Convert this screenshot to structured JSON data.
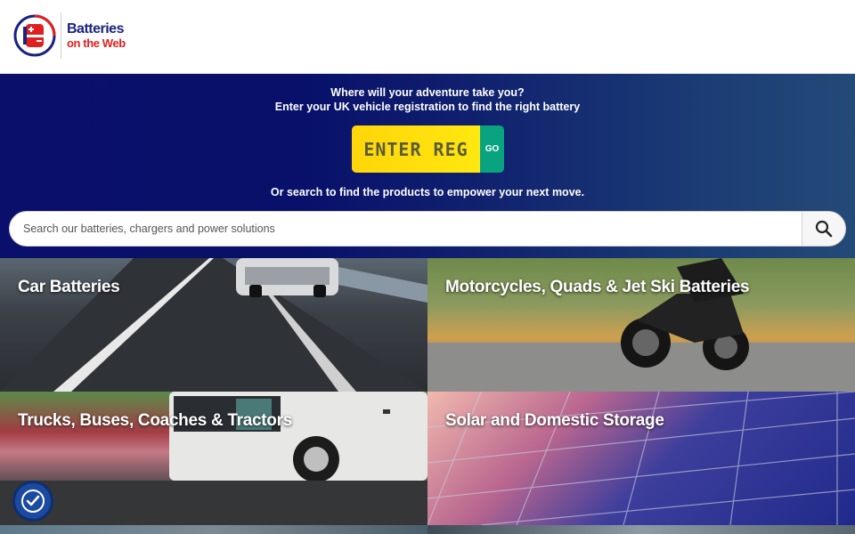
{
  "brand": {
    "name_line1": "Batteries",
    "name_line2": "on the Web",
    "primary_color": "#1a237e",
    "accent_color": "#e02020"
  },
  "hero": {
    "headline": "Where will your adventure take you?",
    "subheadline": "Enter your UK vehicle registration to find the right battery",
    "reg_placeholder": "ENTER REG",
    "go_label": "GO",
    "search_prompt": "Or search to find the products to empower your next move.",
    "search_placeholder": "Search our batteries, chargers and power solutions",
    "search_icon": "search-icon"
  },
  "categories": [
    {
      "title": "Car Batteries"
    },
    {
      "title": "Motorcycles, Quads & Jet Ski Batteries"
    },
    {
      "title": "Trucks, Buses, Coaches & Tractors"
    },
    {
      "title": "Solar and Domestic Storage"
    }
  ],
  "accessibility": {
    "icon": "accessibility-icon",
    "color": "#1c4aa0"
  }
}
